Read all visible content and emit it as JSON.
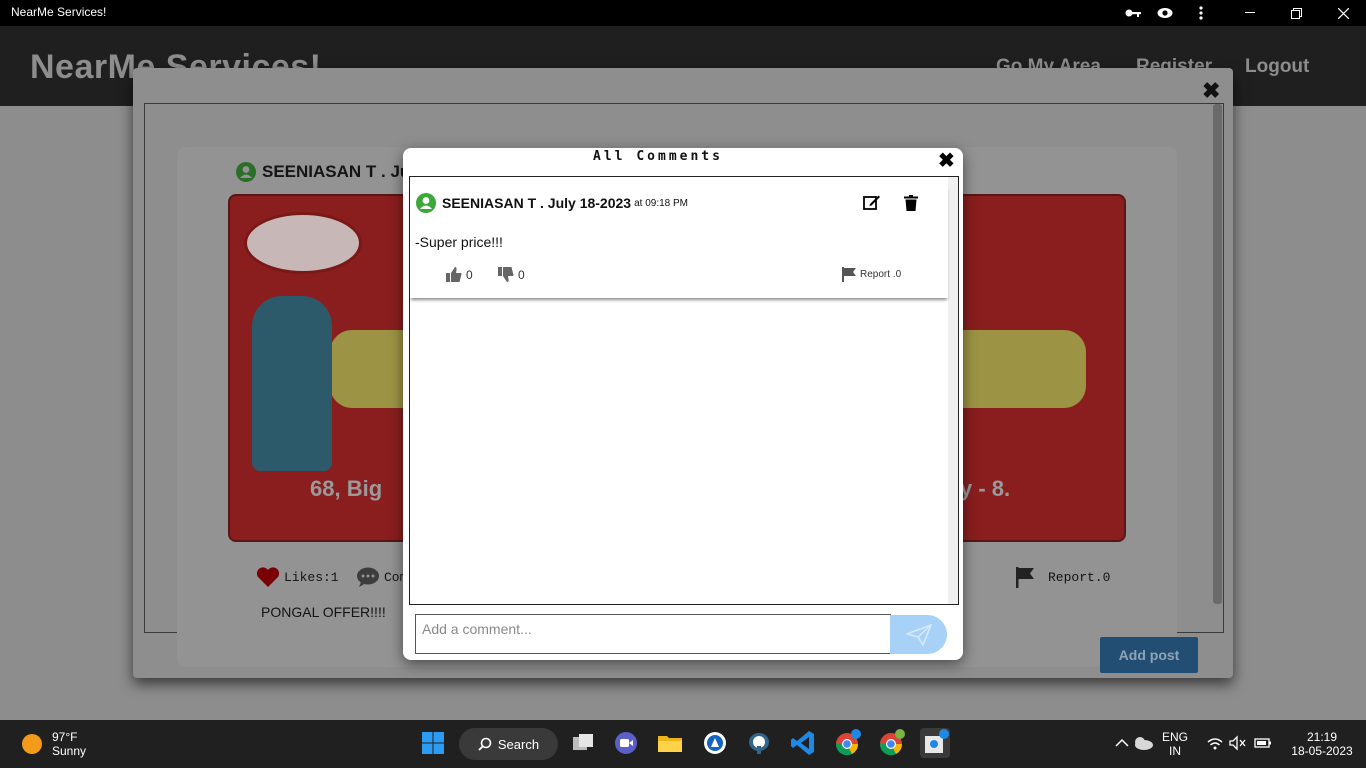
{
  "window": {
    "title": "NearMe Services!"
  },
  "navbar": {
    "brand": "NearMe Services!",
    "links": [
      "Go My Area",
      "Register",
      "Logout"
    ]
  },
  "post": {
    "author": "SEENIASAN T . Ju",
    "image_text_left": "68, Big",
    "image_text_right": "y - 8.",
    "likes": "Likes:1",
    "comments": "Com",
    "report": "Report.0",
    "caption": "PONGAL OFFER!!!!"
  },
  "footer": {
    "add_post": "Add post"
  },
  "comments_modal": {
    "title": "All Comments",
    "comment": {
      "author": "SEENIASAN T . July 18-2023",
      "time": "at 09:18 PM",
      "text": "-Super price!!!",
      "likes": "0",
      "dislikes": "0",
      "report": "Report .0"
    },
    "input_placeholder": "Add a comment..."
  },
  "taskbar": {
    "weather_temp": "97°F",
    "weather_desc": "Sunny",
    "search": "Search",
    "lang": "ENG",
    "region": "IN",
    "time": "21:19",
    "date": "18-05-2023"
  },
  "colors": {
    "accent": "#234e73",
    "send": "#a8d1f7",
    "like_red": "#d9000d",
    "user_green": "#3aa83a"
  }
}
